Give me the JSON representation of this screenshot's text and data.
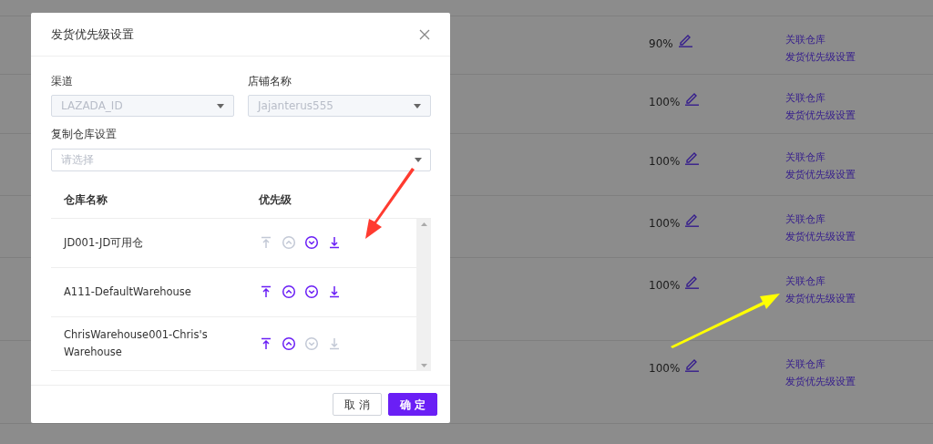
{
  "background_table": {
    "rows": [
      {
        "ratio": "90%",
        "actions": [
          "关联仓库",
          "发货优先级设置"
        ]
      },
      {
        "ratio": "100%",
        "actions": [
          "关联仓库",
          "发货优先级设置"
        ]
      },
      {
        "ratio": "100%",
        "actions": [
          "关联仓库",
          "发货优先级设置"
        ]
      },
      {
        "ratio": "100%",
        "actions": [
          "关联仓库",
          "发货优先级设置"
        ]
      },
      {
        "ratio": "100%",
        "actions": [
          "关联仓库",
          "发货优先级设置"
        ]
      },
      {
        "ratio": "100%",
        "actions": [
          "关联仓库",
          "发货优先级设置"
        ]
      }
    ]
  },
  "dialog": {
    "title": "发货优先级设置",
    "fields": [
      {
        "label": "渠道",
        "value": "LAZADA_ID",
        "disabled": true
      },
      {
        "label": "店铺名称",
        "value": "Jajanterus555",
        "disabled": true
      }
    ],
    "copy_field": {
      "label": "复制仓库设置",
      "placeholder": "请选择"
    },
    "table": {
      "columns": [
        "仓库名称",
        "优先级"
      ],
      "rows": [
        {
          "name": "JD001-JD可用仓",
          "actions": [
            {
              "kind": "top",
              "disabled": true
            },
            {
              "kind": "up",
              "disabled": true
            },
            {
              "kind": "down",
              "disabled": false
            },
            {
              "kind": "bottom",
              "disabled": false
            }
          ]
        },
        {
          "name": "A111-DefaultWarehouse",
          "actions": [
            {
              "kind": "top",
              "disabled": false
            },
            {
              "kind": "up",
              "disabled": false
            },
            {
              "kind": "down",
              "disabled": false
            },
            {
              "kind": "bottom",
              "disabled": false
            }
          ]
        },
        {
          "name": "ChrisWarehouse001-Chris's Warehouse",
          "actions": [
            {
              "kind": "top",
              "disabled": false
            },
            {
              "kind": "up",
              "disabled": false
            },
            {
              "kind": "down",
              "disabled": true
            },
            {
              "kind": "bottom",
              "disabled": true
            }
          ]
        }
      ]
    },
    "buttons": [
      {
        "label": "取 消",
        "kind": "secondary"
      },
      {
        "label": "确 定",
        "kind": "primary"
      }
    ]
  },
  "annotations": [
    {
      "kind": "arrow",
      "color": "#ff3b30"
    },
    {
      "kind": "arrow",
      "color": "#ffff00"
    }
  ]
}
